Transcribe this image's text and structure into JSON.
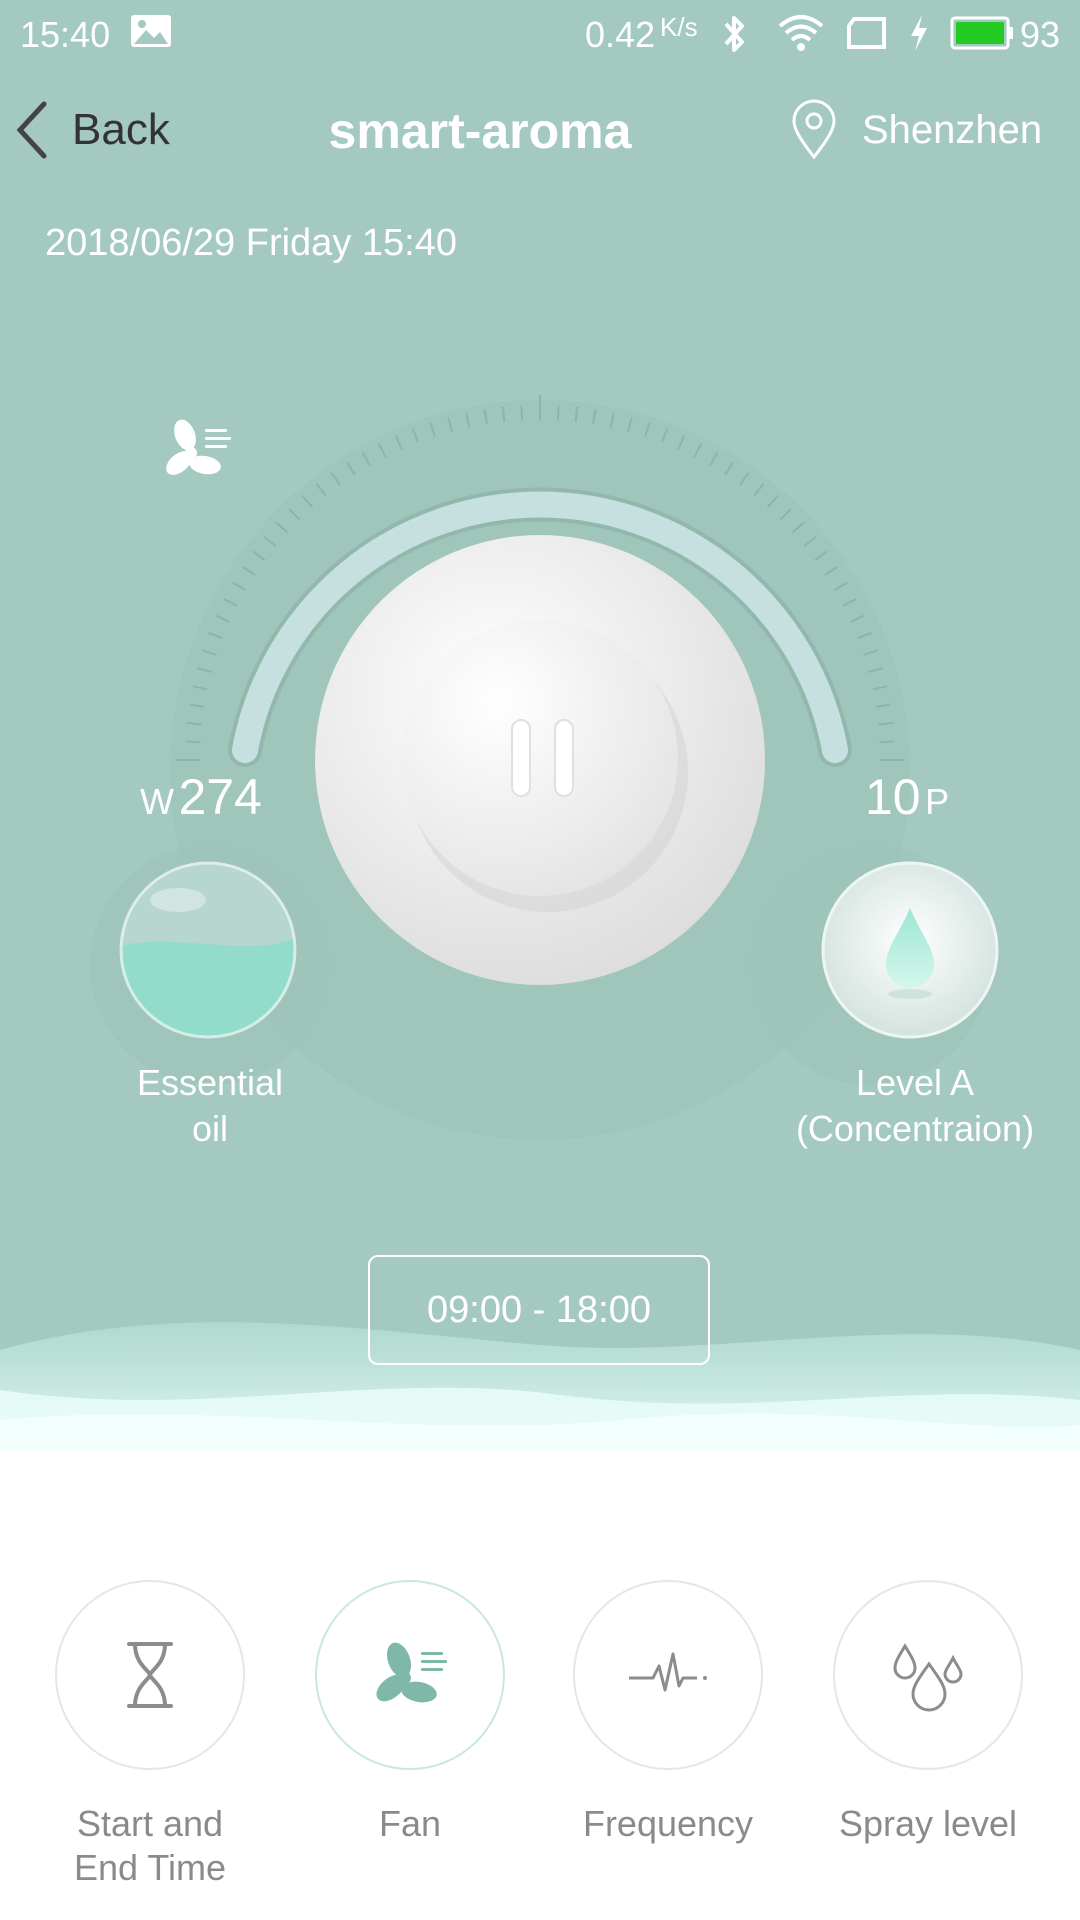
{
  "status_bar": {
    "time": "15:40",
    "net_speed": "0.42",
    "net_speed_unit": "K/s",
    "battery_percent": "93",
    "icons": [
      "image-icon",
      "bluetooth-icon",
      "wifi-icon",
      "sim-icon",
      "charging-icon",
      "battery-icon"
    ]
  },
  "header": {
    "back_label": "Back",
    "title": "smart-aroma",
    "location": "Shenzhen"
  },
  "datetime": "2018/06/29 Friday 15:40",
  "dial": {
    "left_unit": "W",
    "left_value": "274",
    "right_value": "10",
    "right_unit": "P",
    "state_icon": "pause-icon",
    "mode_icon": "fan-icon"
  },
  "oil": {
    "label_line1": "Essential",
    "label_line2": "oil",
    "fill_fraction": 0.55
  },
  "concentration": {
    "label_line1": "Level A",
    "label_line2": "(Concentraion)"
  },
  "schedule": "09:00 - 18:00",
  "tabs": [
    {
      "line1": "Start and",
      "line2": "End Time",
      "icon": "hourglass-icon",
      "active": false
    },
    {
      "line1": "Fan",
      "line2": "",
      "icon": "fan-icon",
      "active": true
    },
    {
      "line1": "Frequency",
      "line2": "",
      "icon": "pulse-icon",
      "active": false
    },
    {
      "line1": "Spray level",
      "line2": "",
      "icon": "droplets-icon",
      "active": false
    }
  ],
  "colors": {
    "panel_bg": "#a3c9c0",
    "accent": "#8fd9c7",
    "tab_icon": "#7fb7a8"
  }
}
